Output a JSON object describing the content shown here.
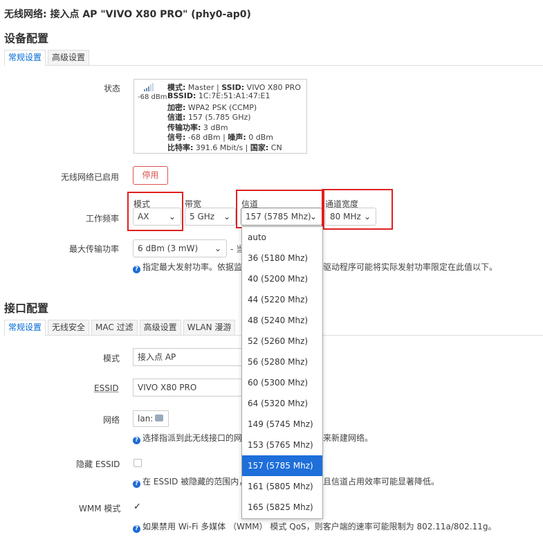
{
  "page": {
    "title": "无线网络: 接入点 AP \"VIVO X80 PRO\" (phy0-ap0)"
  },
  "device_config": {
    "heading": "设备配置",
    "tabs": [
      "常规设置",
      "高级设置"
    ],
    "status": {
      "label": "状态",
      "signal": "-68 dBm",
      "line1_mode_label": "模式:",
      "line1_mode": "Master",
      "line1_ssid_label": "SSID:",
      "line1_ssid": "VIVO X80 PRO",
      "bssid_label": "BSSID:",
      "bssid": "1C:7E:51:A1:47:E1",
      "encryption_label": "加密:",
      "encryption": "WPA2 PSK (CCMP)",
      "channel_label": "信道:",
      "channel": "157 (5.785 GHz)",
      "txpower_label": "传输功率:",
      "txpower": "3 dBm",
      "signal_label": "信号:",
      "signal_val": "-68 dBm",
      "noise_label": "噪声:",
      "noise": "0 dBm",
      "bitrate_label": "比特率:",
      "bitrate": "391.6 Mbit/s",
      "country_label": "国家:",
      "country": "CN"
    },
    "enabled": {
      "label": "无线网络已启用",
      "button": "停用"
    },
    "frequency": {
      "label": "工作频率",
      "mode_label": "模式",
      "mode_value": "AX",
      "band_label": "带宽",
      "band_value": "5 GHz",
      "channel_label": "信道",
      "channel_value": "157 (5785 Mhz)",
      "width_label": "通道宽度",
      "width_value": "80 MHz"
    },
    "max_power": {
      "label": "最大传输功率",
      "value": "6 dBm (3 mW)",
      "suffix": "- 当",
      "hint_left": "指定最大发射功率。依据监",
      "hint_right": "驱动程序可能将实际发射功率限定在此值以下。"
    },
    "channel_options": [
      "auto",
      "36 (5180 Mhz)",
      "40 (5200 Mhz)",
      "44 (5220 Mhz)",
      "48 (5240 Mhz)",
      "52 (5260 Mhz)",
      "56 (5280 Mhz)",
      "60 (5300 Mhz)",
      "64 (5320 Mhz)",
      "149 (5745 Mhz)",
      "153 (5765 Mhz)",
      "157 (5785 Mhz)",
      "161 (5805 Mhz)",
      "165 (5825 Mhz)"
    ],
    "channel_selected": "157 (5785 Mhz)"
  },
  "interface_config": {
    "heading": "接口配置",
    "tabs": [
      "常规设置",
      "无线安全",
      "MAC 过滤",
      "高级设置",
      "WLAN 漫游"
    ],
    "mode": {
      "label": "模式",
      "value": "接入点 AP"
    },
    "essid": {
      "label": "ESSID",
      "value": "VIVO X80 PRO"
    },
    "network": {
      "label": "网络",
      "value": "lan:",
      "hint_left": "选择指派到此无线接口的网",
      "hint_right": "来新建网络。"
    },
    "hidden": {
      "label": "隐藏 ESSID",
      "hint_left": "在 ESSID 被隐藏的范围内，",
      "hint_right": "且信道占用效率可能显著降低。"
    },
    "wmm": {
      "label": "WMM 模式",
      "hint": "如果禁用 Wi-Fi 多媒体 （WMM） 模式 QoS，则客户端的速率可能限制为 802.11a/802.11g。"
    }
  },
  "colors": {
    "accent": "#0069d6",
    "danger": "#d9534f",
    "highlight_box": "#e02020",
    "selected_option": "#1e6fd9"
  }
}
